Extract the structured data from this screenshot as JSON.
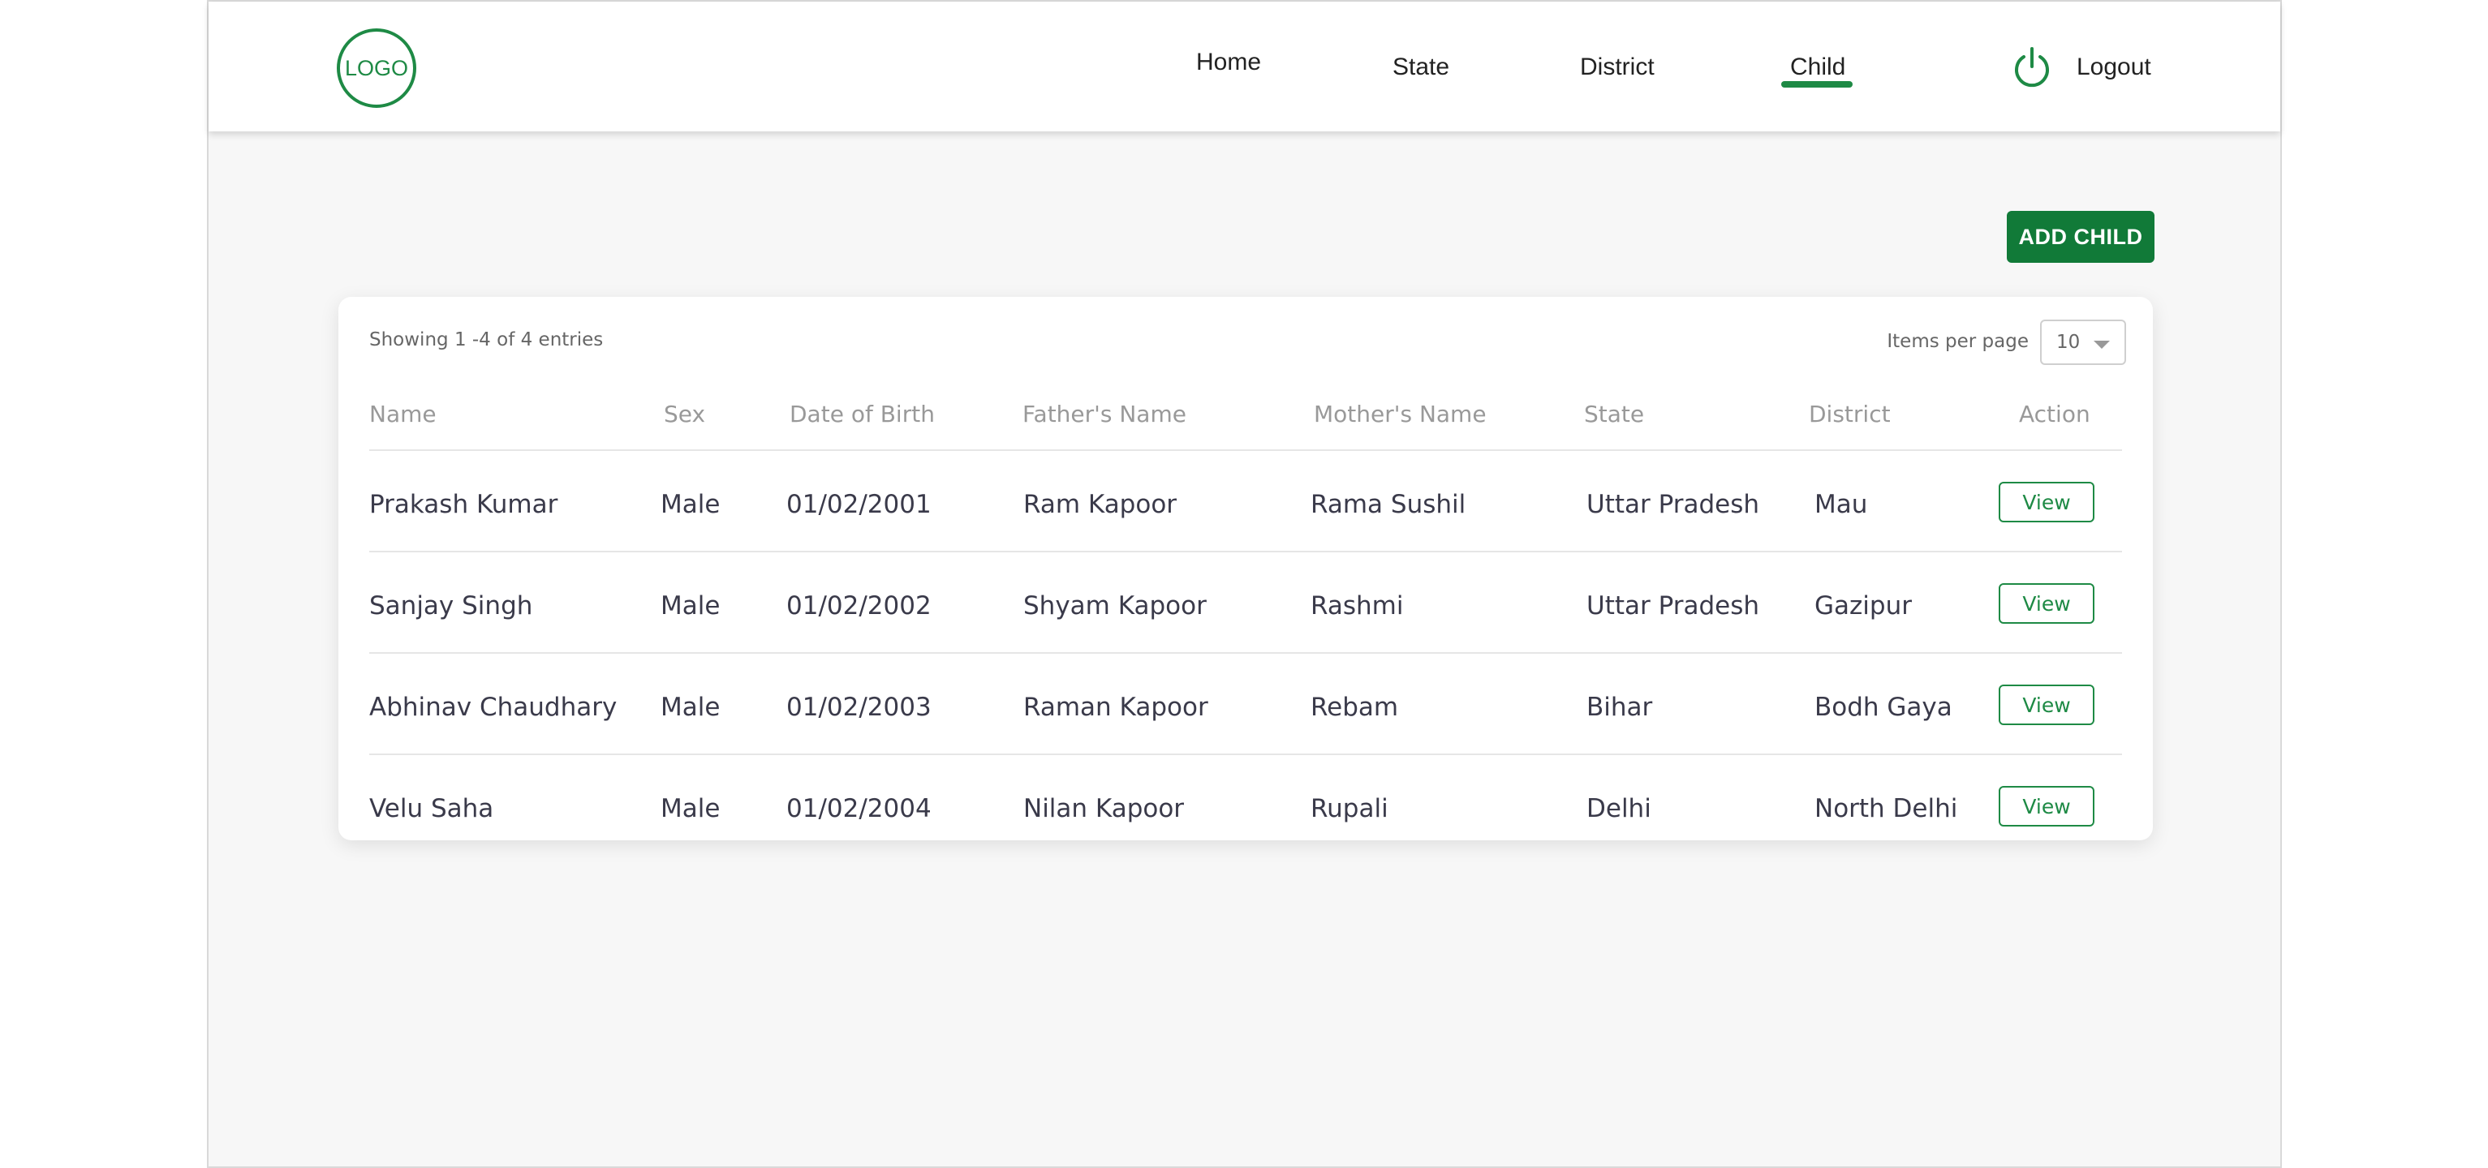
{
  "header": {
    "logo_text": "LOGO",
    "nav": {
      "home": "Home",
      "state": "State",
      "district": "District",
      "child": "Child",
      "logout": "Logout"
    },
    "active_item": "Child"
  },
  "actions": {
    "add_child": "ADD CHILD"
  },
  "table_meta": {
    "showing": "Showing 1 -4 of 4 entries",
    "items_per_page_label": "Items per page",
    "items_per_page_value": "10"
  },
  "table": {
    "columns": [
      "Name",
      "Sex",
      "Date of Birth",
      "Father's Name",
      "Mother's Name",
      "State",
      "District",
      "Action"
    ],
    "rows": [
      {
        "name": "Prakash Kumar",
        "sex": "Male",
        "dob": "01/02/2001",
        "father": "Ram Kapoor",
        "mother": "Rama Sushil",
        "state": "Uttar Pradesh",
        "district": "Mau",
        "action": "View"
      },
      {
        "name": "Sanjay Singh",
        "sex": "Male",
        "dob": "01/02/2002",
        "father": "Shyam Kapoor",
        "mother": "Rashmi",
        "state": "Uttar Pradesh",
        "district": "Gazipur",
        "action": "View"
      },
      {
        "name": "Abhinav Chaudhary",
        "sex": "Male",
        "dob": "01/02/2003",
        "father": "Raman Kapoor",
        "mother": "Rebam",
        "state": "Bihar",
        "district": "Bodh Gaya",
        "action": "View"
      },
      {
        "name": "Velu Saha",
        "sex": "Male",
        "dob": "01/02/2004",
        "father": "Nilan Kapoor",
        "mother": "Rupali",
        "state": "Delhi",
        "district": "North Delhi",
        "action": "View"
      }
    ]
  },
  "colors": {
    "brand_green": "#117a38",
    "accent_green": "#1e8a45",
    "background": "#f7f7f7"
  },
  "icons": {
    "logout": "power-icon"
  }
}
